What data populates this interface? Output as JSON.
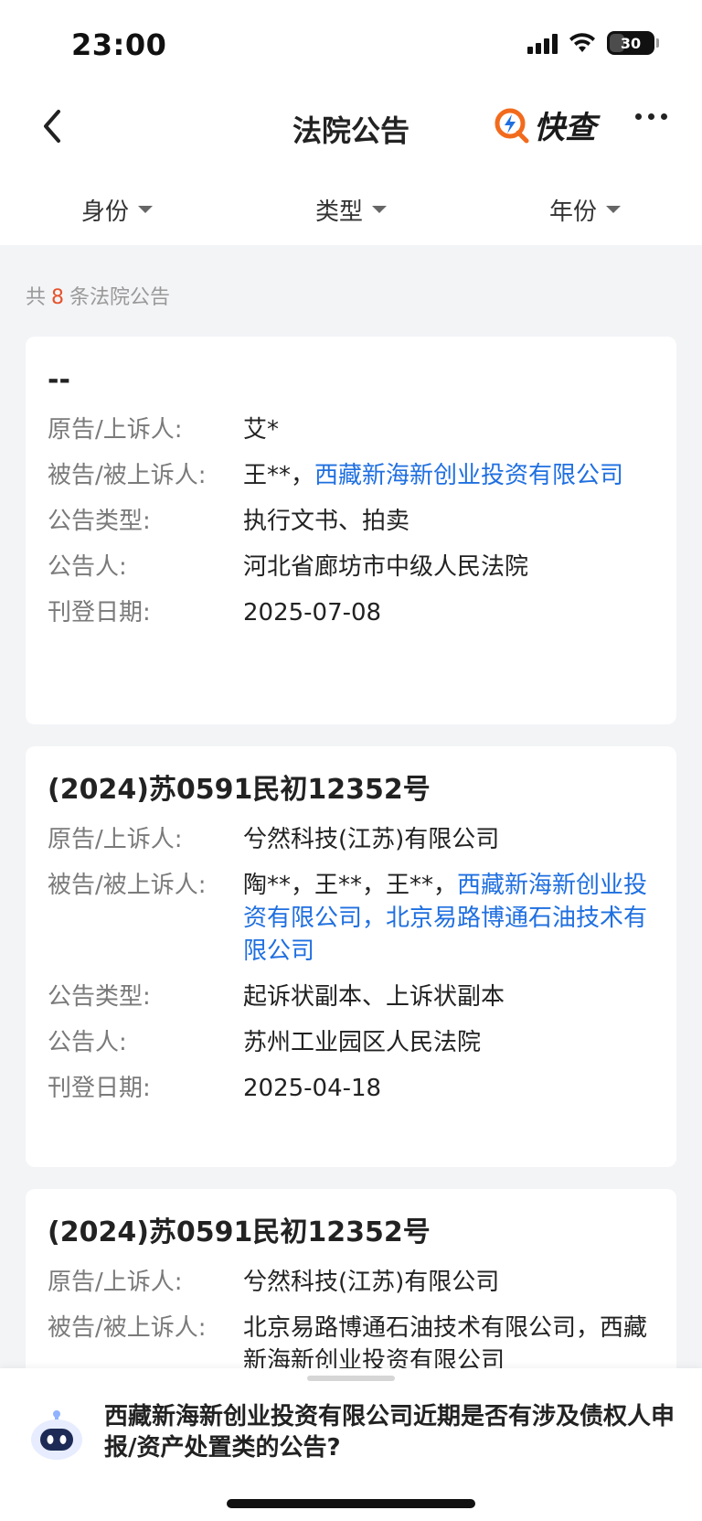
{
  "status": {
    "time": "23:00",
    "battery": "30"
  },
  "nav": {
    "title": "法院公告",
    "brand": "快查"
  },
  "filters": [
    {
      "label": "身份"
    },
    {
      "label": "类型"
    },
    {
      "label": "年份"
    }
  ],
  "count": {
    "prefix": "共",
    "number": "8",
    "suffix": "条法院公告"
  },
  "cards": [
    {
      "title": "--",
      "plaintiff_label": "原告/上诉人:",
      "plaintiff": "艾*",
      "defendant_label": "被告/被上诉人:",
      "defendant_plain": "王**，",
      "defendant_link": "西藏新海新创业投资有限公司",
      "type_label": "公告类型:",
      "type": "执行文书、拍卖",
      "announcer_label": "公告人:",
      "announcer": "河北省廊坊市中级人民法院",
      "date_label": "刊登日期:",
      "date": "2025-07-08"
    },
    {
      "title": "(2024)苏0591民初12352号",
      "plaintiff_label": "原告/上诉人:",
      "plaintiff": "兮然科技(江苏)有限公司",
      "defendant_label": "被告/被上诉人:",
      "defendant_plain": "陶**，王**，王**，",
      "defendant_link": "西藏新海新创业投资有限公司，北京易路博通石油技术有限公司",
      "type_label": "公告类型:",
      "type": "起诉状副本、上诉状副本",
      "announcer_label": "公告人:",
      "announcer": "苏州工业园区人民法院",
      "date_label": "刊登日期:",
      "date": "2025-04-18"
    },
    {
      "title": "(2024)苏0591民初12352号",
      "plaintiff_label": "原告/上诉人:",
      "plaintiff": "兮然科技(江苏)有限公司",
      "defendant_label": "被告/被上诉人:",
      "defendant_link": "北京易路博通石油技术有限公司，西藏新海新创业投资有限公司"
    }
  ],
  "chat": {
    "question": "西藏新海新创业投资有限公司近期是否有涉及债权人申报/资产处置类的公告?"
  }
}
